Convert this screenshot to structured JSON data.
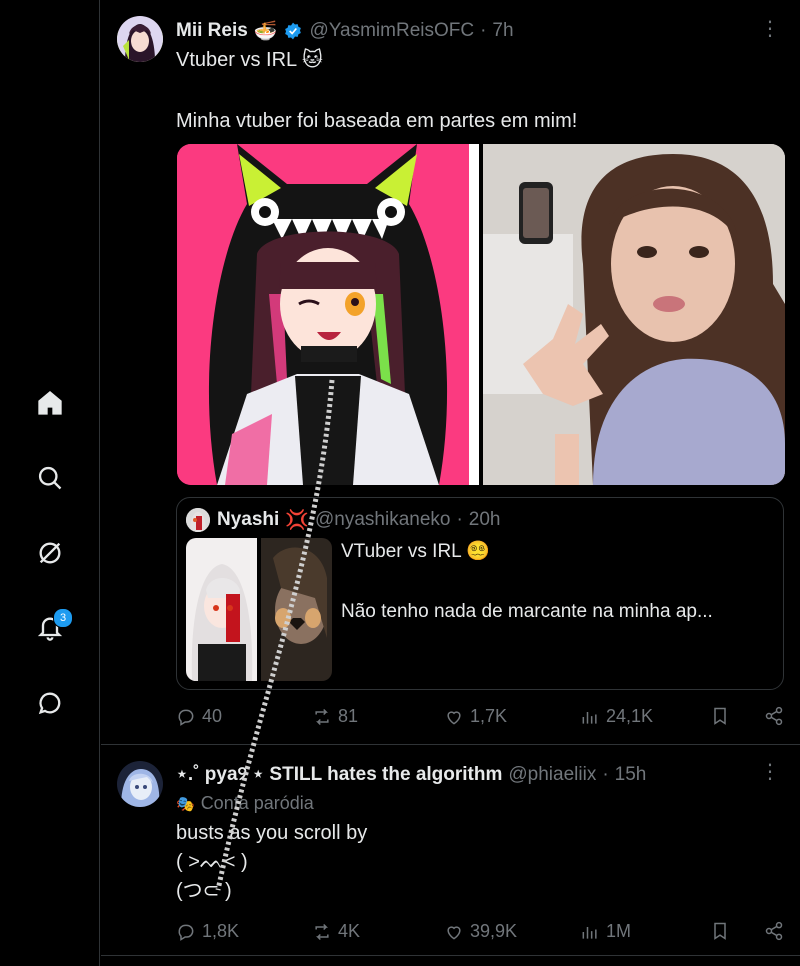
{
  "nav": {
    "notifications_badge": "3"
  },
  "post1": {
    "name": "Mii Reis",
    "name_emoji": "🍜",
    "handle": "@YasmimReisOFC",
    "time": "7h",
    "line1": "Vtuber vs IRL 🐱",
    "line2": "Minha vtuber foi baseada em partes em mim!",
    "quote": {
      "name": "Nyashi",
      "name_emoji": "💢",
      "handle": "@nyashikaneko",
      "time": "20h",
      "line1": "VTuber vs IRL 😵‍💫",
      "line2": "Não tenho nada de marcante na minha ap..."
    },
    "stats": {
      "replies": "40",
      "reposts": "81",
      "likes": "1,7K",
      "views": "24,1K"
    }
  },
  "post2": {
    "name": "⋆.˚ pya୨ ⋆ STILL hates the algorithm",
    "handle": "@phiaeliix",
    "time": "15h",
    "label": "Conta paródia",
    "label_icon": "🎭",
    "line1": "busts as you scroll by",
    "line2": "( >ᨓ< )",
    "line3": "(つ⊂ )",
    "stats": {
      "replies": "1,8K",
      "reposts": "4K",
      "likes": "39,9K",
      "views": "1M"
    }
  },
  "colors": {
    "accent": "#1d9bf0",
    "muted": "#71767b",
    "text": "#e7e9ea",
    "border": "#2f3336"
  }
}
